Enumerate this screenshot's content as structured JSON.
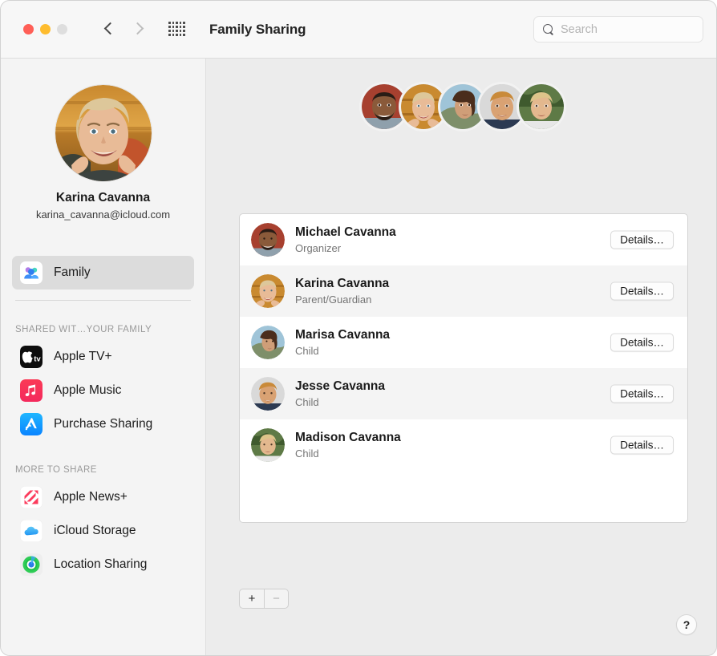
{
  "window": {
    "title": "Family Sharing",
    "traffic_lights": [
      "close",
      "minimize",
      "zoom"
    ],
    "back_icon": "chevron-left-icon",
    "forward_icon": "chevron-right-icon",
    "grid_icon": "grid-apps-icon"
  },
  "search": {
    "placeholder": "Search",
    "value": "",
    "icon": "search-icon"
  },
  "sidebar": {
    "profile": {
      "name": "Karina Cavanna",
      "email": "karina_cavanna@icloud.com",
      "avatar": "user-avatar"
    },
    "primary_items": [
      {
        "label": "Family",
        "icon": "family-group-icon",
        "selected": true
      }
    ],
    "sections": [
      {
        "header": "SHARED WIT…YOUR FAMILY",
        "items": [
          {
            "label": "Apple TV+",
            "icon": "apple-tv-icon"
          },
          {
            "label": "Apple Music",
            "icon": "apple-music-icon"
          },
          {
            "label": "Purchase Sharing",
            "icon": "app-store-icon"
          }
        ]
      },
      {
        "header": "MORE TO SHARE",
        "items": [
          {
            "label": "Apple News+",
            "icon": "apple-news-icon"
          },
          {
            "label": "iCloud Storage",
            "icon": "icloud-icon"
          },
          {
            "label": "Location Sharing",
            "icon": "find-my-icon"
          }
        ]
      }
    ]
  },
  "main": {
    "title": "Family Sharing",
    "avatar_cluster": [
      "michael",
      "karina",
      "marisa",
      "jesse",
      "madison"
    ],
    "members": [
      {
        "name": "Michael Cavanna",
        "role": "Organizer",
        "button": "Details…"
      },
      {
        "name": "Karina Cavanna",
        "role": "Parent/Guardian",
        "button": "Details…"
      },
      {
        "name": "Marisa Cavanna",
        "role": "Child",
        "button": "Details…"
      },
      {
        "name": "Jesse Cavanna",
        "role": "Child",
        "button": "Details…"
      },
      {
        "name": "Madison Cavanna",
        "role": "Child",
        "button": "Details…"
      }
    ],
    "add_label": "+",
    "remove_label": "−",
    "help_label": "?"
  },
  "colors": {
    "window_bg": "#ececec",
    "sidebar_bg": "#f4f4f4",
    "titlebar_bg": "#f7f7f7",
    "selected_row": "#dcdcdc",
    "alt_row": "#f4f4f4",
    "close_red": "#ff5f57",
    "min_yellow": "#febc2e",
    "zoom_gray": "#dedede"
  }
}
